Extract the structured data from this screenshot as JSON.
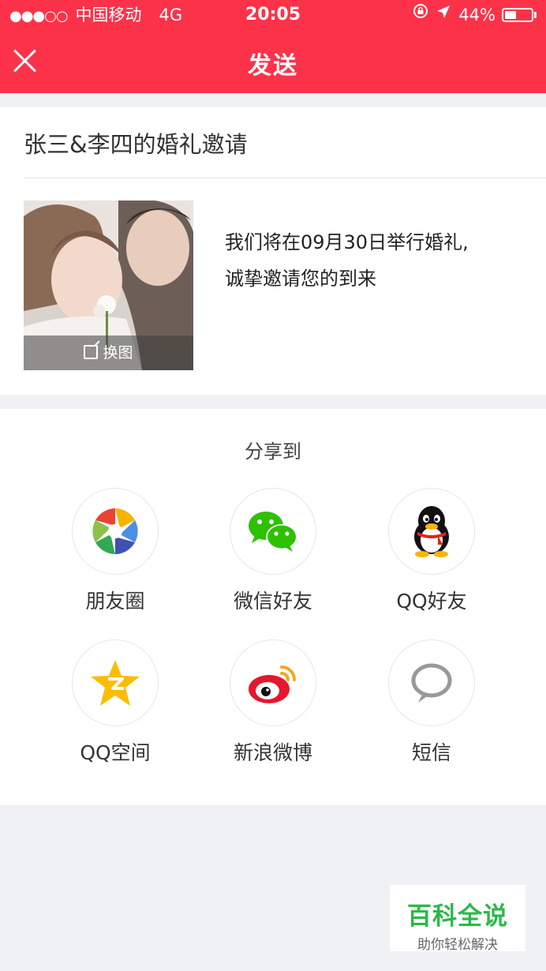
{
  "status_bar": {
    "signal": "●●●○○",
    "carrier": "中国移动",
    "network": "4G",
    "time": "20:05",
    "battery_text": "44%",
    "battery_level": 0.44
  },
  "header": {
    "title": "发送"
  },
  "invitation": {
    "title": "张三&李四的婚礼邀请",
    "change_image_label": "换图",
    "description_line1": "我们将在09月30日举行婚礼,",
    "description_line2": "诚挚邀请您的到来"
  },
  "share": {
    "title": "分享到",
    "items": [
      {
        "label": "朋友圈",
        "icon": "moments-icon"
      },
      {
        "label": "微信好友",
        "icon": "wechat-icon"
      },
      {
        "label": "QQ好友",
        "icon": "qq-icon"
      },
      {
        "label": "QQ空间",
        "icon": "qzone-icon"
      },
      {
        "label": "新浪微博",
        "icon": "weibo-icon"
      },
      {
        "label": "短信",
        "icon": "sms-icon"
      }
    ]
  },
  "watermark": {
    "main": "百科全说",
    "sub": "助你轻松解决"
  },
  "colors": {
    "header_bg": "#fc3249",
    "page_bg": "#f0f1f5",
    "watermark_green": "#2db84a"
  }
}
